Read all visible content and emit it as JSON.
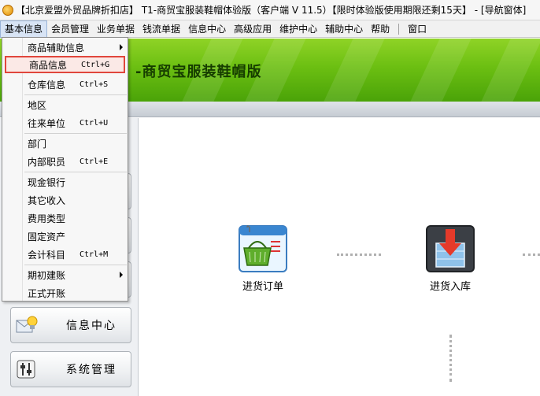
{
  "window": {
    "title": "【北京爱盟外贸品牌折扣店】 T1-商贸宝服装鞋帽体验版（客户端 V 11.5）【限时体验版使用期限还剩15天】 - [导航窗体]"
  },
  "menubar": {
    "items": [
      "基本信息",
      "会员管理",
      "业务单据",
      "钱流单据",
      "信息中心",
      "高级应用",
      "维护中心",
      "辅助中心",
      "帮助",
      "窗口"
    ],
    "active_index": 0
  },
  "banner": {
    "title": "-商贸宝服装鞋帽版"
  },
  "dropdown": {
    "items": [
      {
        "label": "商品辅助信息",
        "shortcut": "",
        "submenu": true
      },
      {
        "label": "商品信息",
        "shortcut": "Ctrl+G",
        "highlighted": true
      },
      {
        "label": "仓库信息",
        "shortcut": "Ctrl+S"
      },
      {
        "label": "地区",
        "shortcut": ""
      },
      {
        "label": "往来单位",
        "shortcut": "Ctrl+U"
      },
      {
        "label": "部门",
        "shortcut": ""
      },
      {
        "label": "内部职员",
        "shortcut": "Ctrl+E"
      },
      {
        "label": "现金银行",
        "shortcut": ""
      },
      {
        "label": "其它收入",
        "shortcut": ""
      },
      {
        "label": "费用类型",
        "shortcut": ""
      },
      {
        "label": "固定资产",
        "shortcut": ""
      },
      {
        "label": "会计科目",
        "shortcut": "Ctrl+M"
      },
      {
        "label": "期初建账",
        "shortcut": "",
        "submenu": true
      },
      {
        "label": "正式开账",
        "shortcut": ""
      }
    ]
  },
  "leftnav": {
    "buttons": [
      {
        "label": "信息中心",
        "icon": "info-center-icon"
      },
      {
        "label": "系统管理",
        "icon": "system-settings-icon"
      }
    ]
  },
  "flow": {
    "nodes": [
      {
        "label": "进货订单",
        "icon": "purchase-order-basket-icon"
      },
      {
        "label": "进货入库",
        "icon": "stock-in-arrow-icon"
      }
    ]
  },
  "colors": {
    "banner_green": "#6cbf12",
    "highlight_border": "#e0463c",
    "menu_active_bg": "#d8e4f5"
  }
}
